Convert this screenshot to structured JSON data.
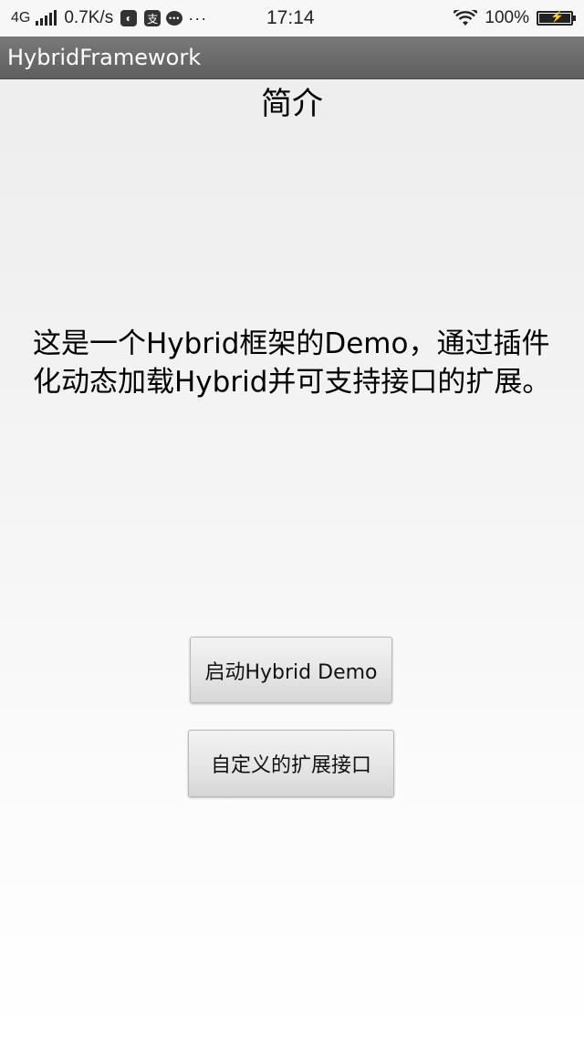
{
  "status_bar": {
    "network": "4G",
    "speed": "0.7K/s",
    "icon_a": "app-notification-icon",
    "icon_b": "alipay-icon",
    "icon_c": "message-icon",
    "more": "···",
    "time": "17:14",
    "battery": "100%",
    "battery_level_percent": 100
  },
  "action_bar": {
    "title": "HybridFramework"
  },
  "main": {
    "heading": "简介",
    "description": "这是一个Hybrid框架的Demo，通过插件化动态加载Hybrid并可支持接口的扩展。",
    "buttons": {
      "launch_label": "启动Hybrid Demo",
      "extend_label": "自定义的扩展接口"
    }
  }
}
